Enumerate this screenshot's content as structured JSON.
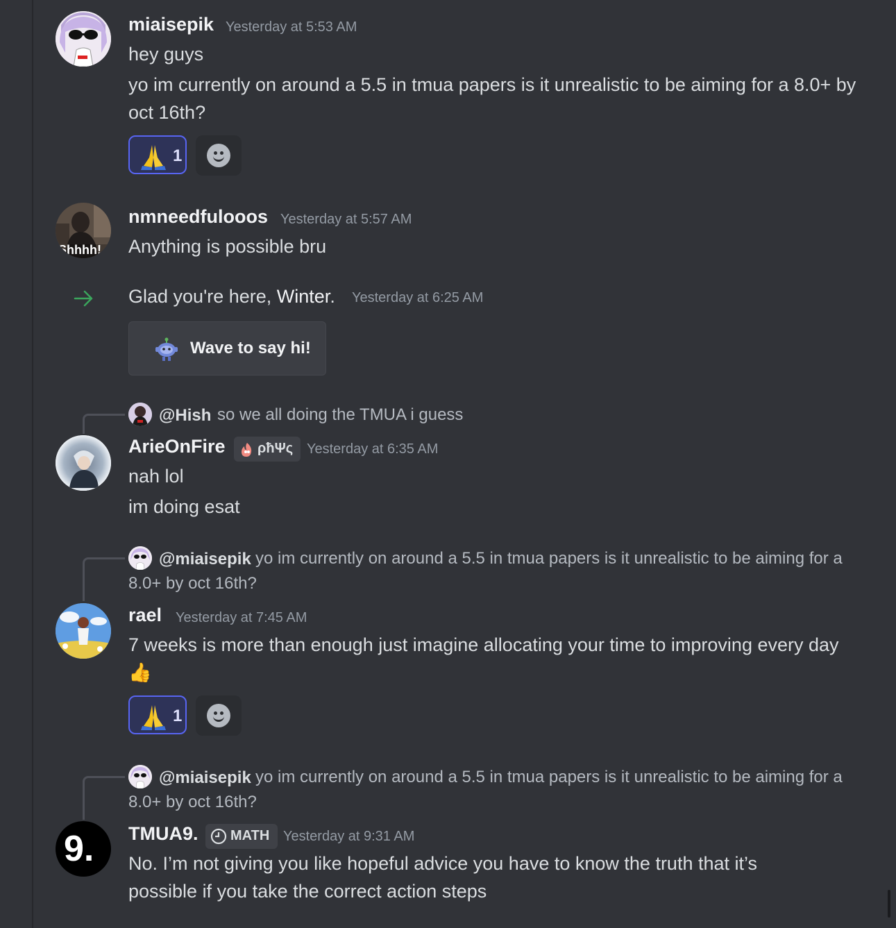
{
  "messages": {
    "m1": {
      "username": "miaisepik",
      "timestamp": "Yesterday at 5:53 AM",
      "line1": "hey guys",
      "line2": "yo im currently on around a 5.5 in tmua papers is it unrealistic to be aiming for a 8.0+ by oct 16th?",
      "reaction": {
        "emoji": "🙏",
        "count": "1"
      }
    },
    "m2": {
      "username": "nmneedfulooos",
      "timestamp": "Yesterday at 5:57 AM",
      "avatar_caption": "Shhhh!",
      "line1": "Anything is possible bru"
    },
    "system": {
      "prefix": "Glad you're here, ",
      "name": "Winter",
      "suffix": ".",
      "timestamp": "Yesterday at 6:25 AM",
      "wave_label": "Wave to say hi!"
    },
    "m3": {
      "reply_name": "@Hish",
      "reply_text": "so we all doing the TMUA i guess",
      "username": "ArieOnFire",
      "tag": "ρħΨς",
      "timestamp": "Yesterday at 6:35 AM",
      "line1": "nah lol",
      "line2": "im doing esat"
    },
    "m4": {
      "reply_name": "@miaisepik",
      "reply_text": "yo im currently on around a 5.5 in tmua papers is it unrealistic to be aiming for a 8.0+ by oct 16th?",
      "username": "rael",
      "timestamp": "Yesterday at 7:45 AM",
      "line1": "7 weeks is more than enough just imagine allocating your time to improving every day 👍",
      "reaction": {
        "emoji": "🙏",
        "count": "1"
      }
    },
    "m5": {
      "reply_name": "@miaisepik",
      "reply_text": "yo im currently on around a 5.5 in tmua papers is it unrealistic to be aiming for a 8.0+ by oct 16th?",
      "username": "TMUA9.",
      "avatar_text": "9.",
      "tag": "MATH",
      "timestamp": "Yesterday at 9:31 AM",
      "line1": "No. I’m not giving you like hopeful advice you have to know the truth that it’s possible if you take the correct action steps"
    }
  },
  "icons": {
    "join_arrow": "arrow-right-icon",
    "add_reaction": "smiley-face-icon",
    "wave_sticker": "wumpus-wave-icon",
    "fire_tag": "fire-icon",
    "clock_tag": "clock-icon"
  },
  "colors": {
    "background": "#313338",
    "accent": "#5865f2",
    "join_arrow": "#3ba55c",
    "muted": "#949ba4"
  }
}
